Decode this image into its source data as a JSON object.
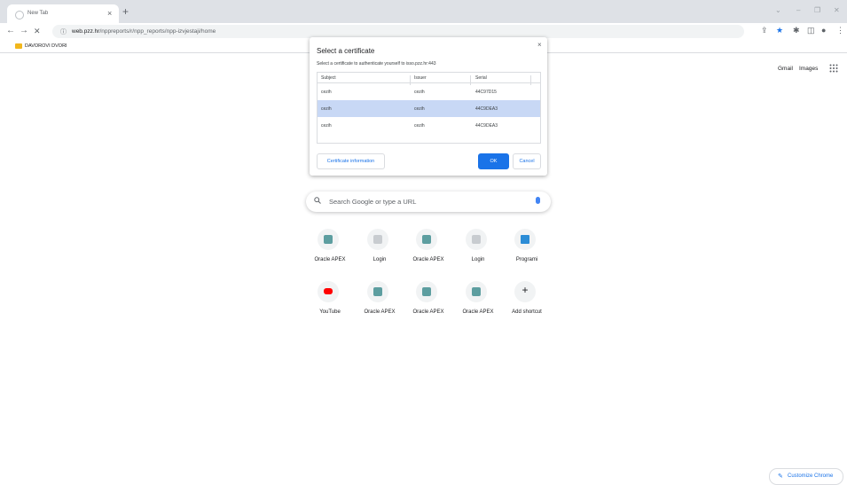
{
  "browser": {
    "tab": {
      "title": "New Tab",
      "close": "×"
    },
    "new_tab": "+",
    "window_controls": {
      "chevron": "⌄",
      "minimize": "–",
      "restore": "❐",
      "close": "✕"
    },
    "nav": {
      "back": "←",
      "forward": "→",
      "stop": "✕"
    },
    "url": {
      "host": "web.pzz.hr",
      "path": "/nppreports/r/npp_reports/npp-izvjestaji/home"
    },
    "toolbar_icons": {
      "share": "⇪",
      "star": "★",
      "extensions": "✱",
      "sidepanel": "◫",
      "profile": "●",
      "menu": "⋮"
    },
    "accent_color": "#1a73e8"
  },
  "bookmarks": [
    {
      "label": "DAVOROVI DVORI"
    }
  ],
  "google_links": {
    "gmail": "Gmail",
    "images": "Images",
    "apps": "⋮⋮⋮"
  },
  "certificate_dialog": {
    "title": "Select a certificate",
    "subtitle": "Select a certificate to authenticate yourself to isso.pzz.hr:443",
    "close": "×",
    "columns": [
      "Subject",
      "Issuer",
      "Serial"
    ],
    "rows": [
      {
        "subject": "cezih",
        "issuer": "cezih",
        "serial": "44C97D15",
        "selected": false
      },
      {
        "subject": "cezih",
        "issuer": "cezih",
        "serial": "44C9DEA3",
        "selected": true
      },
      {
        "subject": "cezih",
        "issuer": "cezih",
        "serial": "44C9DEA3",
        "selected": false
      }
    ],
    "buttons": {
      "info": "Certificate information",
      "ok": "OK",
      "cancel": "Cancel"
    }
  },
  "search": {
    "placeholder": "Search Google or type a URL",
    "icon": "⚲"
  },
  "shortcuts": [
    {
      "label": "Oracle APEX",
      "icon": "apex-icon"
    },
    {
      "label": "Login",
      "icon": "login-icon"
    },
    {
      "label": "Oracle APEX",
      "icon": "apex-icon"
    },
    {
      "label": "Login",
      "icon": "login-icon"
    },
    {
      "label": "Programi",
      "icon": "programi-icon"
    },
    {
      "label": "YouTube",
      "icon": "youtube-icon"
    },
    {
      "label": "Oracle APEX",
      "icon": "apex-icon"
    },
    {
      "label": "Oracle APEX",
      "icon": "apex-icon"
    },
    {
      "label": "Oracle APEX",
      "icon": "apex-icon"
    },
    {
      "label": "Add shortcut",
      "icon": "add-icon",
      "glyph": "+"
    }
  ],
  "customize": {
    "label": "Customize Chrome",
    "icon": "✎"
  }
}
